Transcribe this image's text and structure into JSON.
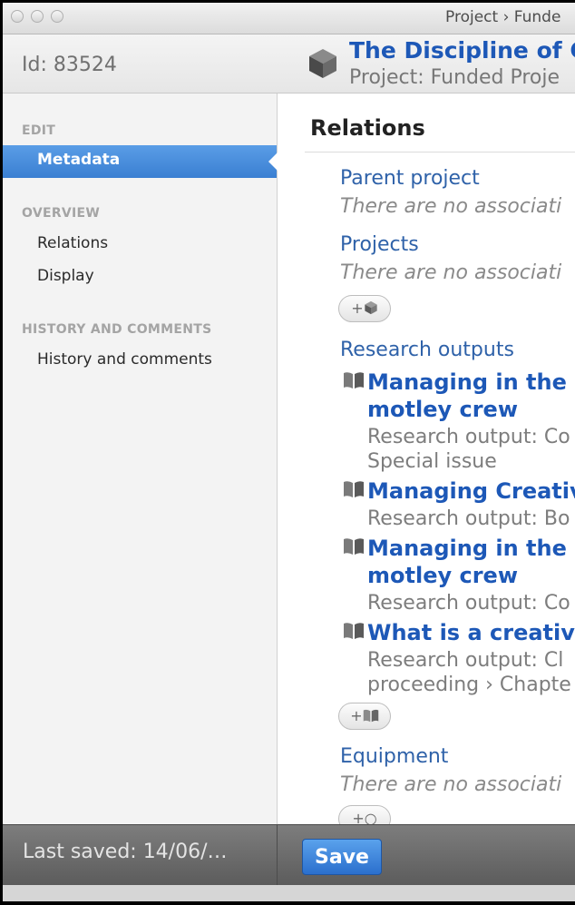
{
  "window": {
    "title": "Project › Funde"
  },
  "header": {
    "id_text": "Id: 83524",
    "title": "The Discipline of C",
    "subtitle": "Project: Funded Proje"
  },
  "sidebar": {
    "sections": [
      {
        "heading": "EDIT",
        "items": [
          "Metadata"
        ]
      },
      {
        "heading": "OVERVIEW",
        "items": [
          "Relations",
          "Display"
        ]
      },
      {
        "heading": "HISTORY AND COMMENTS",
        "items": [
          "History and comments"
        ]
      }
    ],
    "active_item": "Metadata"
  },
  "main": {
    "heading": "Relations",
    "parent_project": {
      "label": "Parent project",
      "empty_text": "There are no associati"
    },
    "projects": {
      "label": "Projects",
      "empty_text": "There are no associati",
      "add_button": "+"
    },
    "research_outputs": {
      "label": "Research outputs",
      "items": [
        {
          "title_lines": [
            "Managing in the C",
            "motley crew"
          ],
          "subtitle_lines": [
            "Research output: Co",
            "Special issue"
          ]
        },
        {
          "title_lines": [
            "Managing Creativ"
          ],
          "subtitle_lines": [
            "Research output: Bo"
          ]
        },
        {
          "title_lines": [
            "Managing in the c",
            "motley crew"
          ],
          "subtitle_lines": [
            "Research output: Co"
          ]
        },
        {
          "title_lines": [
            "What is a creative"
          ],
          "subtitle_lines": [
            "Research output: Cl",
            "proceeding › Chapte"
          ]
        }
      ],
      "add_button": "+"
    },
    "equipment": {
      "label": "Equipment",
      "empty_text": "There are no associati",
      "add_button": "+"
    }
  },
  "footer": {
    "last_saved": "Last saved: 14/06/…",
    "save_button": "Save"
  },
  "icons": {
    "project": "cube-icon",
    "research_output": "book-icon"
  },
  "colors": {
    "link_blue": "#1d58b7",
    "label_blue": "#2f62a9",
    "active_nav": "#3a7fd2",
    "save_button": "#2b6fcd",
    "footer": "#666666"
  }
}
